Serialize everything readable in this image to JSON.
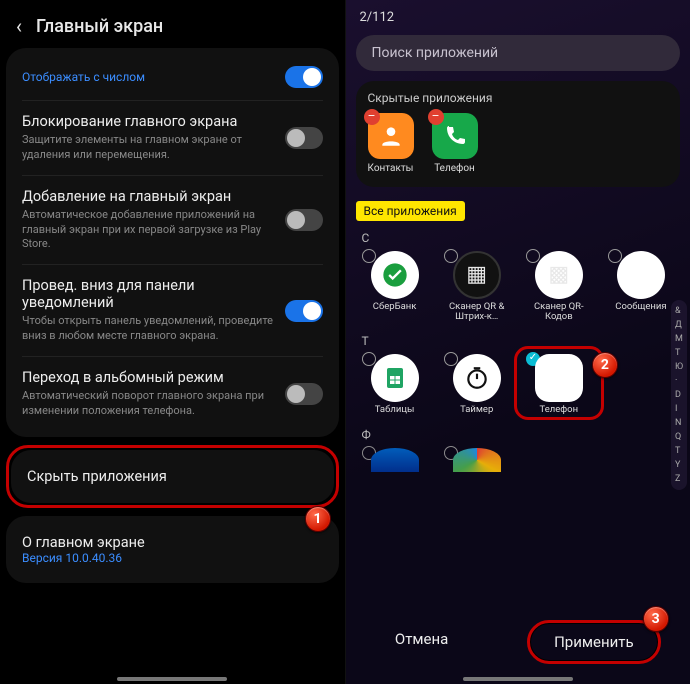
{
  "left": {
    "header_title": "Главный экран",
    "row0_link": "Отображать с числом",
    "row1_title": "Блокирование главного экрана",
    "row1_sub": "Защитите элементы на главном экране от удаления или перемещения.",
    "row2_title": "Добавление на главный экран",
    "row2_sub": "Автоматическое добавление приложений на главный экран при их первой загрузке из Play Store.",
    "row3_title": "Провед. вниз для панели уведомлений",
    "row3_sub": "Чтобы открыть панель уведомлений, проведите вниз в любом месте главного экрана.",
    "row4_title": "Переход в альбомный режим",
    "row4_sub": "Автоматический поворот главного экрана при изменении положения телефона.",
    "row5_title": "Скрыть приложения",
    "row6_title": "О главном экране",
    "row6_sub": "Версия 10.0.40.36",
    "badge1": "1"
  },
  "right": {
    "counter": "2/112",
    "search_placeholder": "Поиск приложений",
    "hidden_label": "Скрытые приложения",
    "hidden_apps": [
      "Контакты",
      "Телефон"
    ],
    "all_apps_tag": "Все приложения",
    "letter_c": "С",
    "letter_t": "Т",
    "letter_f": "Ф",
    "apps_c": [
      "СберБанк",
      "Сканер QR & Штрих-к…",
      "Сканер QR-Кодов",
      "Сообщения"
    ],
    "apps_t": [
      "Таблицы",
      "Таймер",
      "Телефон"
    ],
    "az_index": [
      "&",
      "Д",
      "М",
      "Т",
      "Ю",
      "·",
      "D",
      "I",
      "N",
      "Q",
      "T",
      "Y",
      "Z"
    ],
    "cancel": "Отмена",
    "apply": "Применить",
    "badge2": "2",
    "badge3": "3"
  }
}
